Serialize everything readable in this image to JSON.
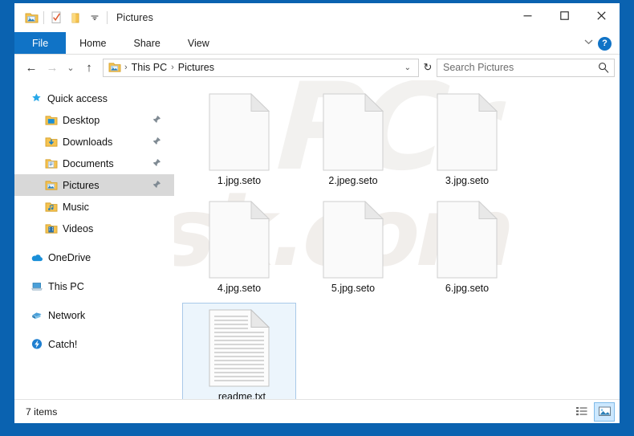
{
  "window": {
    "title": "Pictures",
    "quick_access_toolbar": [
      {
        "name": "pictures-folder-icon",
        "label": "Pictures folder"
      },
      {
        "name": "properties-icon",
        "label": "Properties"
      },
      {
        "name": "new-folder-icon",
        "label": "New folder"
      },
      {
        "name": "customize-chevron-icon",
        "label": "Customize Quick Access Toolbar"
      }
    ],
    "controls": {
      "minimize": "─",
      "maximize": "☐",
      "close": "✕"
    },
    "frame_color": "#0a62b0"
  },
  "ribbon": {
    "tabs": [
      {
        "label": "File",
        "selected": true
      },
      {
        "label": "Home",
        "selected": false
      },
      {
        "label": "Share",
        "selected": false
      },
      {
        "label": "View",
        "selected": false
      }
    ],
    "expand_chevron": "⌄",
    "help_label": "?",
    "accent_color": "#1073c6"
  },
  "address_bar": {
    "back": "←",
    "forward": "→",
    "recent": "⌄",
    "up": "↑",
    "breadcrumb": {
      "icon": "pictures-folder-icon",
      "separator": "›",
      "parts": [
        "This PC",
        "Pictures"
      ]
    },
    "crumb_dropdown": "⌄",
    "refresh": "↻"
  },
  "search": {
    "placeholder": "Search Pictures",
    "value": "",
    "icon": "search-icon"
  },
  "sidebar": {
    "groups": [
      {
        "items": [
          {
            "label": "Quick access",
            "icon": "star-pin-icon",
            "indent": false,
            "selected": false,
            "pinned": false
          },
          {
            "label": "Desktop",
            "icon": "desktop-folder-icon",
            "indent": true,
            "selected": false,
            "pinned": true
          },
          {
            "label": "Downloads",
            "icon": "downloads-folder-icon",
            "indent": true,
            "selected": false,
            "pinned": true
          },
          {
            "label": "Documents",
            "icon": "documents-folder-icon",
            "indent": true,
            "selected": false,
            "pinned": true
          },
          {
            "label": "Pictures",
            "icon": "pictures-folder-icon",
            "indent": true,
            "selected": true,
            "pinned": true
          },
          {
            "label": "Music",
            "icon": "music-folder-icon",
            "indent": true,
            "selected": false,
            "pinned": false
          },
          {
            "label": "Videos",
            "icon": "videos-folder-icon",
            "indent": true,
            "selected": false,
            "pinned": false
          }
        ]
      },
      {
        "items": [
          {
            "label": "OneDrive",
            "icon": "onedrive-cloud-icon",
            "indent": false,
            "selected": false,
            "pinned": false
          }
        ]
      },
      {
        "items": [
          {
            "label": "This PC",
            "icon": "this-pc-icon",
            "indent": false,
            "selected": false,
            "pinned": false
          }
        ]
      },
      {
        "items": [
          {
            "label": "Network",
            "icon": "network-icon",
            "indent": false,
            "selected": false,
            "pinned": false
          }
        ]
      },
      {
        "items": [
          {
            "label": "Catch!",
            "icon": "catch-icon",
            "indent": false,
            "selected": false,
            "pinned": false
          }
        ]
      }
    ]
  },
  "files": [
    {
      "name": "1.jpg.seto",
      "icon": "blank-file-icon",
      "selected": false
    },
    {
      "name": "2.jpeg.seto",
      "icon": "blank-file-icon",
      "selected": false
    },
    {
      "name": "3.jpg.seto",
      "icon": "blank-file-icon",
      "selected": false
    },
    {
      "name": "4.jpg.seto",
      "icon": "blank-file-icon",
      "selected": false
    },
    {
      "name": "5.jpg.seto",
      "icon": "blank-file-icon",
      "selected": false
    },
    {
      "name": "6.jpg.seto",
      "icon": "blank-file-icon",
      "selected": false
    },
    {
      "name": "_readme.txt",
      "icon": "text-file-icon",
      "selected": true
    }
  ],
  "watermark": {
    "line1": "PCr",
    "line2": "isk.com"
  },
  "status_bar": {
    "item_count": "7 items",
    "views": [
      {
        "name": "details-view-icon",
        "label": "Details view",
        "active": false
      },
      {
        "name": "large-icons-view-icon",
        "label": "Large icons view",
        "active": true
      }
    ]
  }
}
